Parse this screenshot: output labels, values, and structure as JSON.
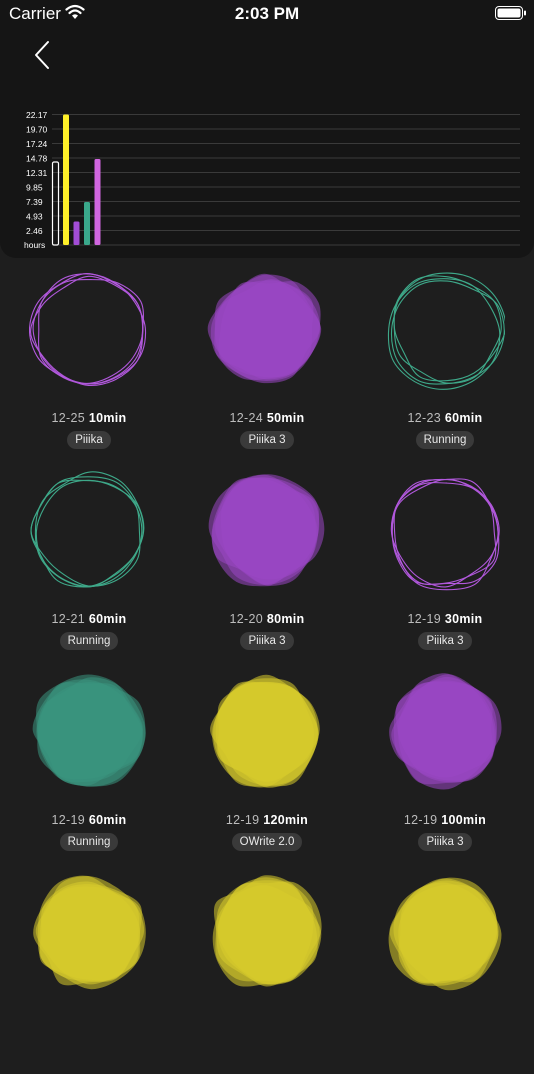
{
  "status_bar": {
    "carrier": "Carrier",
    "time": "2:03 PM"
  },
  "chart_data": {
    "type": "bar",
    "ylabel": "hours",
    "yticks": [
      "22.17",
      "19.70",
      "17.24",
      "14.78",
      "12.31",
      "9.85",
      "7.39",
      "4.93",
      "2.46"
    ],
    "ylim": [
      0,
      24.63
    ],
    "grid": true,
    "series": [
      {
        "values": [
          14.1
        ],
        "color": "#ffffff",
        "outline": true
      },
      {
        "values": [
          22.17
        ],
        "color": "#fff029"
      },
      {
        "values": [
          4.0
        ],
        "color": "#a24dd6"
      },
      {
        "values": [
          7.3
        ],
        "color": "#3aa88b"
      },
      {
        "values": [
          14.6
        ],
        "color": "#d166e0"
      }
    ]
  },
  "sessions": [
    {
      "date": "12-25",
      "duration": "10min",
      "tag": "Piiika",
      "color": "#b158dc",
      "style": "outline"
    },
    {
      "date": "12-24",
      "duration": "50min",
      "tag": "Piiika 3",
      "color": "#9a47c4",
      "style": "filled"
    },
    {
      "date": "12-23",
      "duration": "60min",
      "tag": "Running",
      "color": "#3ea889",
      "style": "outline"
    },
    {
      "date": "12-21",
      "duration": "60min",
      "tag": "Running",
      "color": "#3ea889",
      "style": "outline"
    },
    {
      "date": "12-20",
      "duration": "80min",
      "tag": "Piiika 3",
      "color": "#9a47c4",
      "style": "filled"
    },
    {
      "date": "12-19",
      "duration": "30min",
      "tag": "Piiika 3",
      "color": "#b158dc",
      "style": "outline"
    },
    {
      "date": "12-19",
      "duration": "60min",
      "tag": "Running",
      "color": "#3a9680",
      "style": "filled"
    },
    {
      "date": "12-19",
      "duration": "120min",
      "tag": "OWrite 2.0",
      "color": "#d9cc2c",
      "style": "filled"
    },
    {
      "date": "12-19",
      "duration": "100min",
      "tag": "Piiika 3",
      "color": "#9a47c4",
      "style": "filled"
    },
    {
      "color": "#d9cc2c",
      "style": "filled"
    },
    {
      "color": "#d9cc2c",
      "style": "filled"
    },
    {
      "color": "#d9cc2c",
      "style": "filled"
    }
  ]
}
